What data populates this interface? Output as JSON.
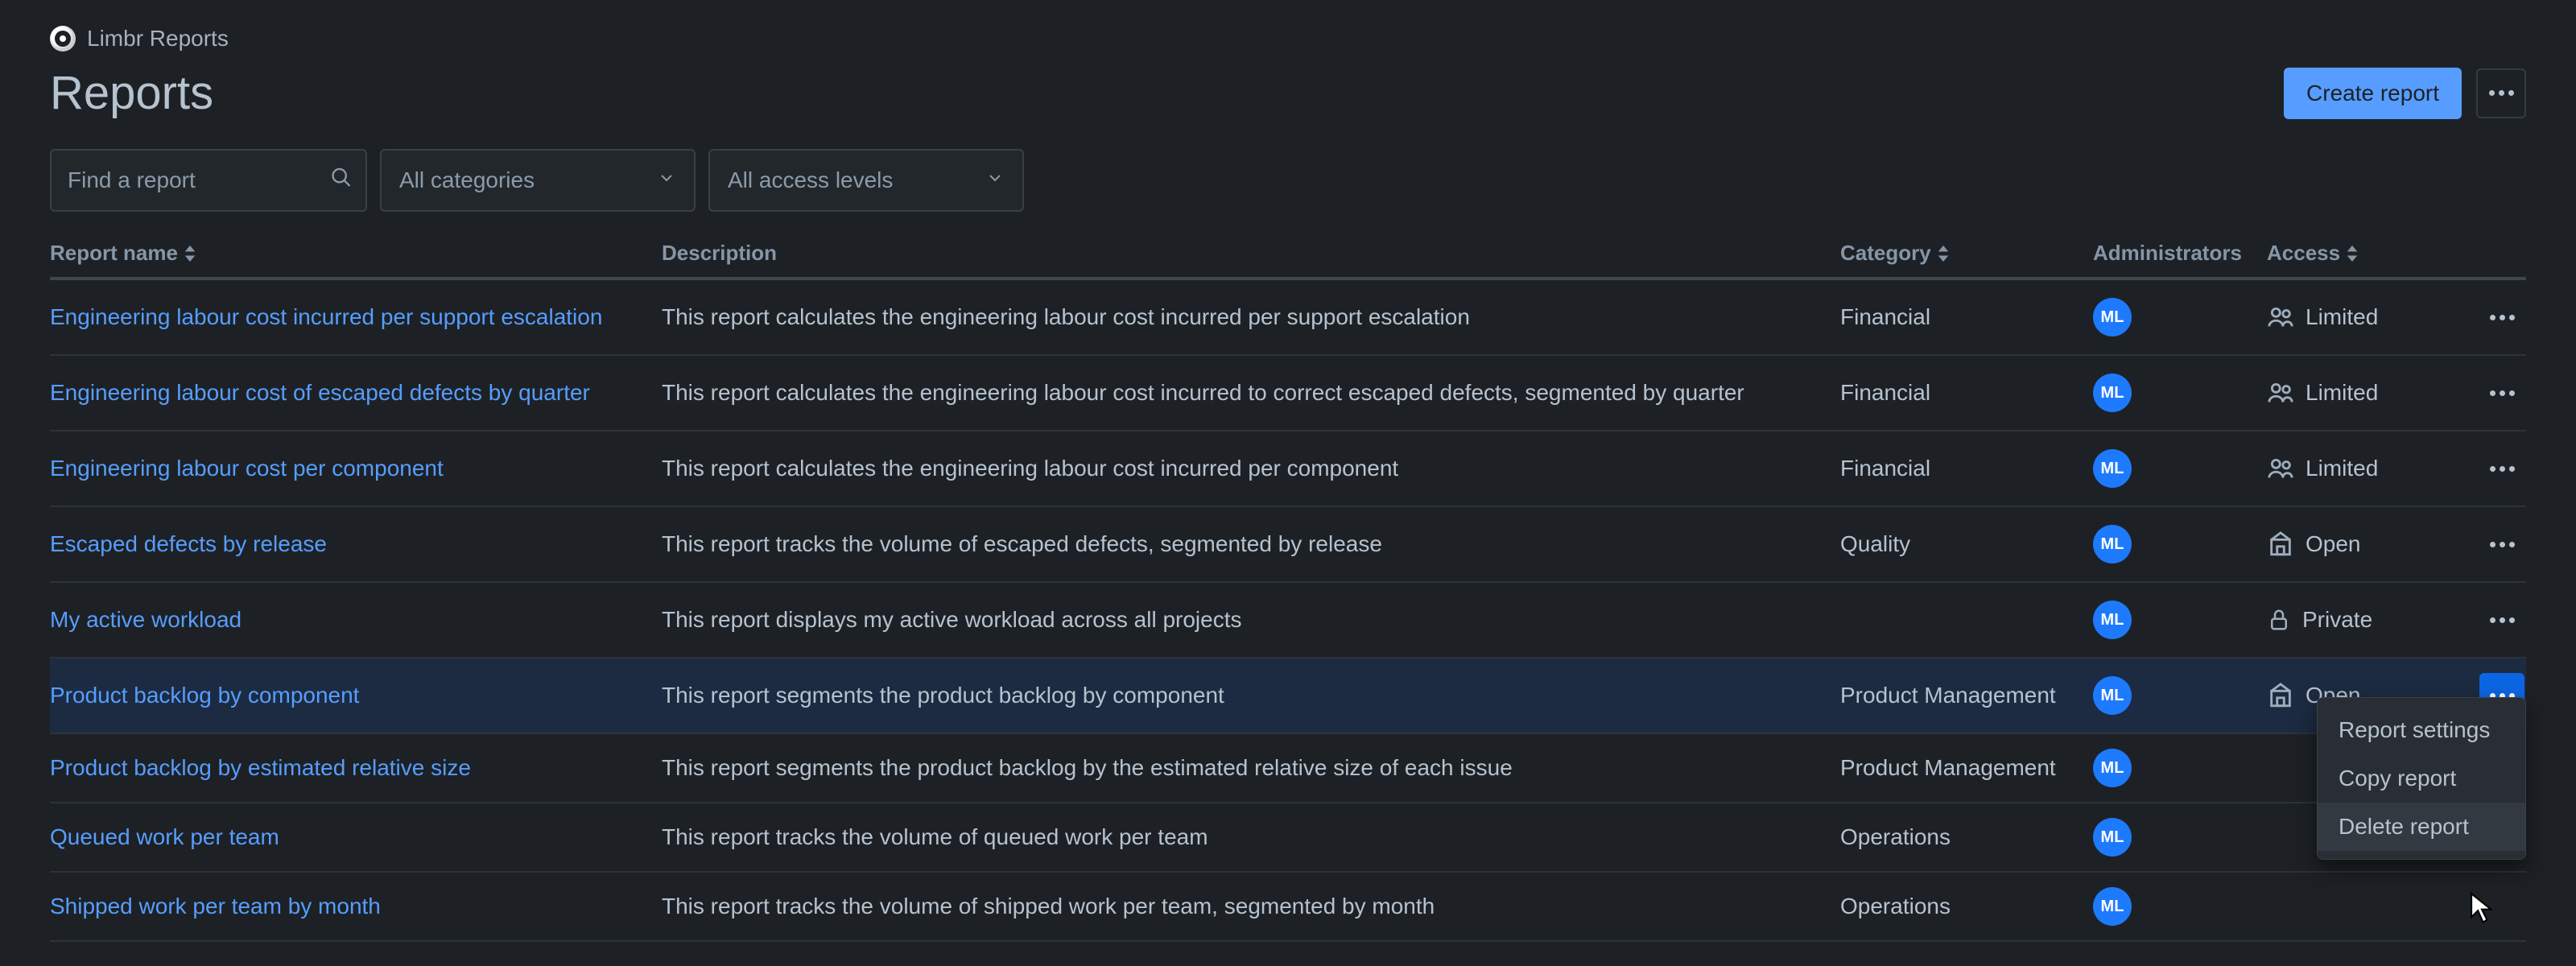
{
  "breadcrumb": {
    "app": "Limbr Reports"
  },
  "page": {
    "title": "Reports"
  },
  "actions": {
    "create": "Create report"
  },
  "filters": {
    "search_placeholder": "Find a report",
    "category_select": "All categories",
    "access_select": "All access levels"
  },
  "columns": {
    "name": "Report name",
    "description": "Description",
    "category": "Category",
    "admins": "Administrators",
    "access": "Access"
  },
  "avatar_initials": "ML",
  "access_labels": {
    "limited": "Limited",
    "open": "Open",
    "private": "Private"
  },
  "rows": [
    {
      "name": "Engineering labour cost incurred per support escalation",
      "desc": "This report calculates the engineering labour cost incurred per support escalation",
      "cat": "Financial",
      "access": "limited"
    },
    {
      "name": "Engineering labour cost of escaped defects by quarter",
      "desc": "This report calculates the engineering labour cost incurred to correct escaped defects, segmented by quarter",
      "cat": "Financial",
      "access": "limited"
    },
    {
      "name": "Engineering labour cost per component",
      "desc": "This report calculates the engineering labour cost incurred per component",
      "cat": "Financial",
      "access": "limited"
    },
    {
      "name": "Escaped defects by release",
      "desc": "This report tracks the volume of escaped defects, segmented by release",
      "cat": "Quality",
      "access": "open"
    },
    {
      "name": "My active workload",
      "desc": "This report displays my active workload across all projects",
      "cat": "",
      "access": "private"
    },
    {
      "name": "Product backlog by component",
      "desc": "This report segments the product backlog by component",
      "cat": "Product Management",
      "access": "open",
      "highlight": true,
      "menu_open": true
    },
    {
      "name": "Product backlog by estimated relative size",
      "desc": "This report segments the product backlog by the estimated relative size of each issue",
      "cat": "Product Management",
      "access": ""
    },
    {
      "name": "Queued work per team",
      "desc": "This report tracks the volume of queued work per team",
      "cat": "Operations",
      "access": ""
    },
    {
      "name": "Shipped work per team by month",
      "desc": "This report tracks the volume of shipped work per team, segmented by month",
      "cat": "Operations",
      "access": ""
    }
  ],
  "menu": {
    "settings": "Report settings",
    "copy": "Copy report",
    "delete": "Delete report"
  }
}
